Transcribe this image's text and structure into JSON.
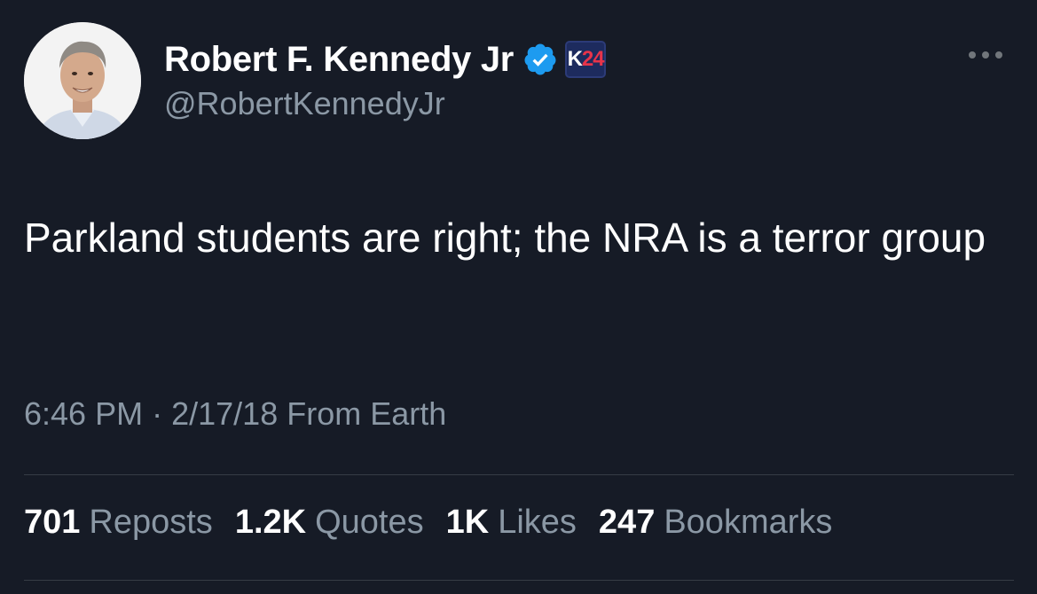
{
  "author": {
    "display_name": "Robert F. Kennedy Jr",
    "handle": "@RobertKennedyJr",
    "verified_icon": "verified-badge-icon",
    "affiliate_badge": {
      "k": "K",
      "num": "24",
      "icon": "k24-affiliate-badge"
    },
    "avatar": "profile-photo"
  },
  "tweet": {
    "text": "Parkland students are right; the NRA is a terror group"
  },
  "meta": {
    "time": "6:46 PM",
    "separator": "·",
    "date": "2/17/18",
    "source": "From Earth"
  },
  "stats": [
    {
      "value": "701",
      "label": "Reposts"
    },
    {
      "value": "1.2K",
      "label": "Quotes"
    },
    {
      "value": "1K",
      "label": "Likes"
    },
    {
      "value": "247",
      "label": "Bookmarks"
    }
  ],
  "colors": {
    "background": "#161b26",
    "verified_blue": "#1d9bf0",
    "muted_text": "#8b98a5",
    "badge_red": "#e8344a"
  }
}
